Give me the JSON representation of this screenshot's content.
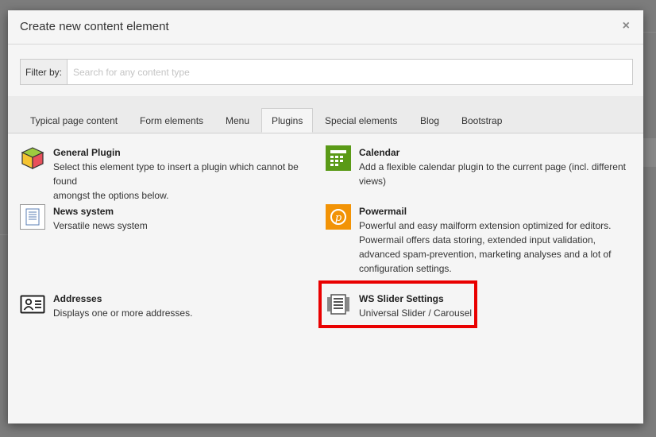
{
  "modal": {
    "title": "Create new content element",
    "close_symbol": "×"
  },
  "filter": {
    "label": "Filter by:",
    "placeholder": "Search for any content type",
    "value": ""
  },
  "tabs": [
    {
      "label": "Typical page content"
    },
    {
      "label": "Form elements"
    },
    {
      "label": "Menu"
    },
    {
      "label": "Plugins",
      "active": true
    },
    {
      "label": "Special elements"
    },
    {
      "label": "Blog"
    },
    {
      "label": "Bootstrap"
    }
  ],
  "items": {
    "general_plugin": {
      "title": "General Plugin",
      "desc_line1": "Select this element type to insert a plugin which cannot be found",
      "desc_line2": "amongst the options below.",
      "icon": "cube-icon"
    },
    "calendar": {
      "title": "Calendar",
      "desc_line1": "Add a flexible calendar plugin to the current page (incl. different",
      "desc_line2": "views)",
      "icon": "calendar-icon"
    },
    "news": {
      "title": "News system",
      "desc_line1": "Versatile news system",
      "icon": "document-icon"
    },
    "powermail": {
      "title": "Powermail",
      "desc_line1": "Powerful and easy mailform extension optimized for editors.",
      "desc_line2": "Powermail offers data storing, extended input validation,",
      "desc_line3": "advanced spam-prevention, marketing analyses and a lot of",
      "desc_line4": "configuration settings.",
      "icon": "powermail-icon"
    },
    "addresses": {
      "title": "Addresses",
      "desc_line1": "Displays one or more addresses.",
      "icon": "address-card-icon"
    },
    "ws_slider": {
      "title": "WS Slider Settings",
      "desc_line1": "Universal Slider / Carousel",
      "icon": "slider-icon"
    }
  },
  "colors": {
    "highlight": "#e90000",
    "calendar_green": "#5a9a17",
    "powermail_orange": "#f29306"
  }
}
